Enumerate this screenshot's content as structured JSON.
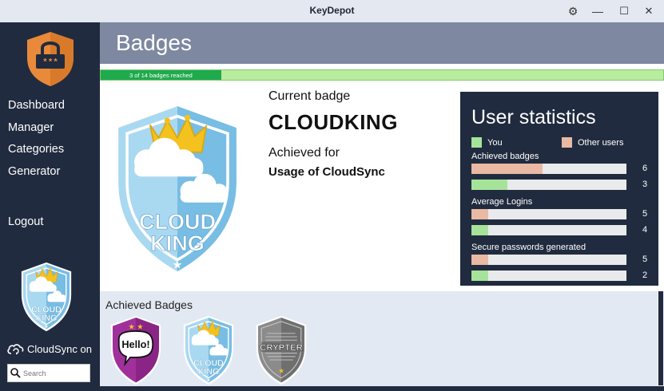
{
  "app": {
    "title": "KeyDepot"
  },
  "window_controls": {
    "settings": "⚙",
    "minimize": "—",
    "maximize": "☐",
    "close": "✕"
  },
  "sidebar": {
    "items": [
      {
        "label": "Dashboard"
      },
      {
        "label": "Manager"
      },
      {
        "label": "Categories"
      },
      {
        "label": "Generator"
      },
      {
        "label": "Logout"
      }
    ],
    "badge": {
      "line1": "CLOUD",
      "line2": "KING"
    },
    "cloudsync_label": "CloudSync on",
    "search": {
      "value": "",
      "placeholder": "Search"
    }
  },
  "header": {
    "title": "Badges"
  },
  "progress": {
    "label": "3 of 14 badges reached",
    "fraction": 0.2143
  },
  "current_badge": {
    "heading": "Current badge",
    "name": "CLOUDKING",
    "achieved_heading": "Achieved for",
    "achieved_for": "Usage of CloudSync",
    "badge_line1": "CLOUD",
    "badge_line2": "KING"
  },
  "stats": {
    "title": "User statistics",
    "legend_you": "You",
    "legend_others": "Other users",
    "colors": {
      "you": "#a6e39a",
      "others": "#e9b9a3"
    },
    "categories": [
      {
        "label": "Achieved badges",
        "others": 6,
        "you": 3,
        "others_fraction": 0.46,
        "you_fraction": 0.23
      },
      {
        "label": "Average Logins",
        "others": 5,
        "you": 4,
        "others_fraction": 0.11,
        "you_fraction": 0.11
      },
      {
        "label": "Secure passwords generated",
        "others": 5,
        "you": 2,
        "others_fraction": 0.11,
        "you_fraction": 0.11
      }
    ]
  },
  "achieved": {
    "title": "Achieved Badges",
    "badges": [
      {
        "name": "hello-badge",
        "text": "Hello!"
      },
      {
        "name": "cloudking-badge",
        "line1": "CLOUD",
        "line2": "KING"
      },
      {
        "name": "crypter-badge",
        "text": "CRYPTER"
      }
    ]
  }
}
